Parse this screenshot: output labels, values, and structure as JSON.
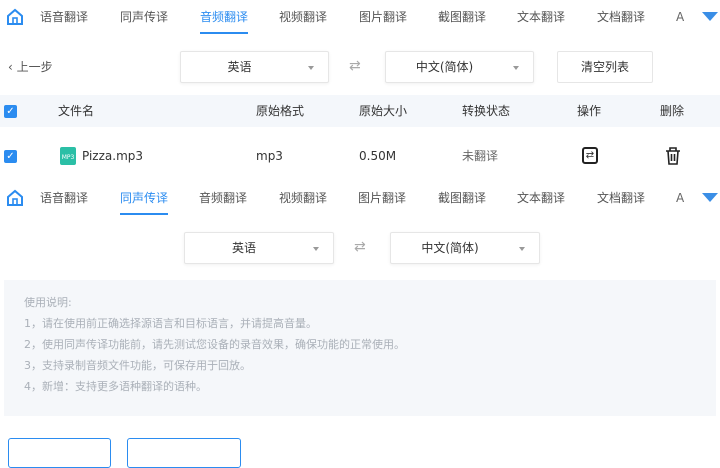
{
  "nav_tabs": [
    "语音翻译",
    "同声传译",
    "音频翻译",
    "视频翻译",
    "图片翻译",
    "截图翻译",
    "文本翻译",
    "文档翻译"
  ],
  "nav_more": "A",
  "panel1": {
    "back": "上一步",
    "source_lang": "英语",
    "target_lang": "中文(简体)",
    "clear_list": "清空列表",
    "columns": [
      "文件名",
      "原始格式",
      "原始大小",
      "转换状态",
      "操作",
      "删除"
    ],
    "rows": [
      {
        "name": "Pizza.mp3",
        "format": "mp3",
        "size": "0.50M",
        "status": "未翻译"
      }
    ]
  },
  "panel2": {
    "source_lang": "英语",
    "target_lang": "中文(简体)",
    "instructions_title": "使用说明:",
    "instructions": [
      "1，请在使用前正确选择源语言和目标语言，并请提高音量。",
      "2，使用同声传译功能前，请先测试您设备的录音效果，确保功能的正常使用。",
      "3，支持录制音频文件功能，可保存用于回放。",
      "4，新增：支持更多语种翻译的语种。"
    ]
  },
  "colors": {
    "accent": "#2b8cf0"
  }
}
